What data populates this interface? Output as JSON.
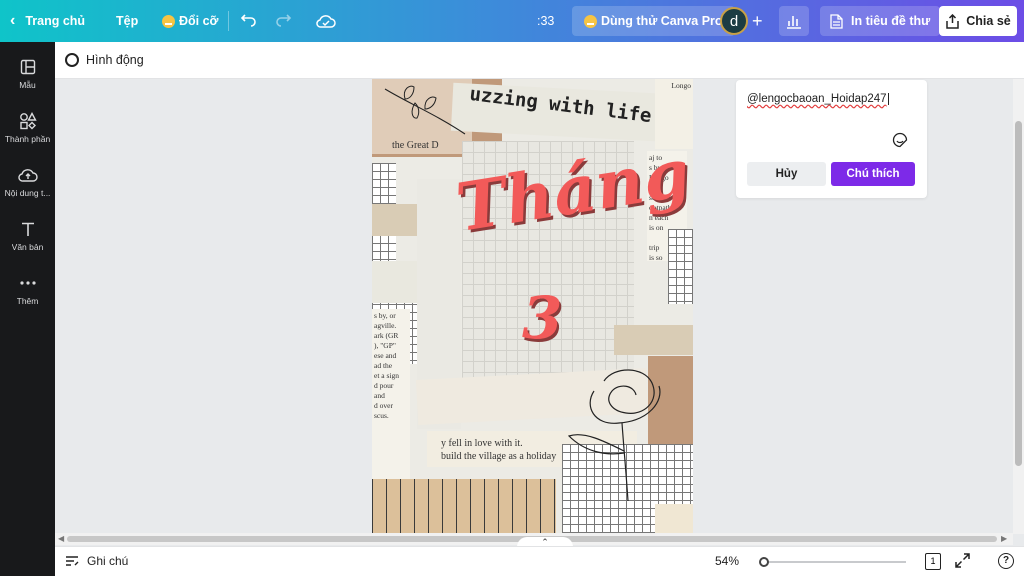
{
  "topbar": {
    "back_label": "Trang chủ",
    "file_label": "Tệp",
    "resize_label": "Đổi cỡ",
    "timer": ":33",
    "pro_label": "Dùng thử Canva Pro",
    "avatar_letter": "d",
    "print_label": "In tiêu đề thư",
    "share_label": "Chia sẻ"
  },
  "sidebar": {
    "items": [
      {
        "label": "Mẫu",
        "icon": "template-icon"
      },
      {
        "label": "Thành phần",
        "icon": "elements-icon"
      },
      {
        "label": "Nội dung t...",
        "icon": "upload-icon"
      },
      {
        "label": "Văn bản",
        "icon": "text-icon"
      },
      {
        "label": "Thêm",
        "icon": "more-icon"
      }
    ]
  },
  "subbar": {
    "animate_label": "Hình động"
  },
  "design": {
    "title_word": "Tháng",
    "title_number": "3",
    "headline": "uzzing with life",
    "texts": {
      "great": "the Great D",
      "longo": "Longo",
      "story": "y fell in love with it.",
      "build": "build the village as a holiday",
      "left_col": "s by, or\nagville.\nark (GR\n), \"GP\"\nese and\nad the\net a sign\nd pour\nand\nd over\nscus.",
      "right_col": "aj to\ns by\nLongo\n\nsopath\nootpath\nn each\nis on\n\ntrip\nis so\nbefore"
    }
  },
  "comment": {
    "value": "@lengocbaoan_Hoidap247",
    "cancel_label": "Hủy",
    "submit_label": "Chú thích"
  },
  "bottombar": {
    "notes_label": "Ghi chú",
    "zoom_label": "54%",
    "zoom_fraction": 0.03,
    "page_count": "1",
    "help_label": "?"
  },
  "colors": {
    "accent": "#7d2ae8",
    "title": "#f25a59",
    "sidebar_bg": "#18191b"
  }
}
